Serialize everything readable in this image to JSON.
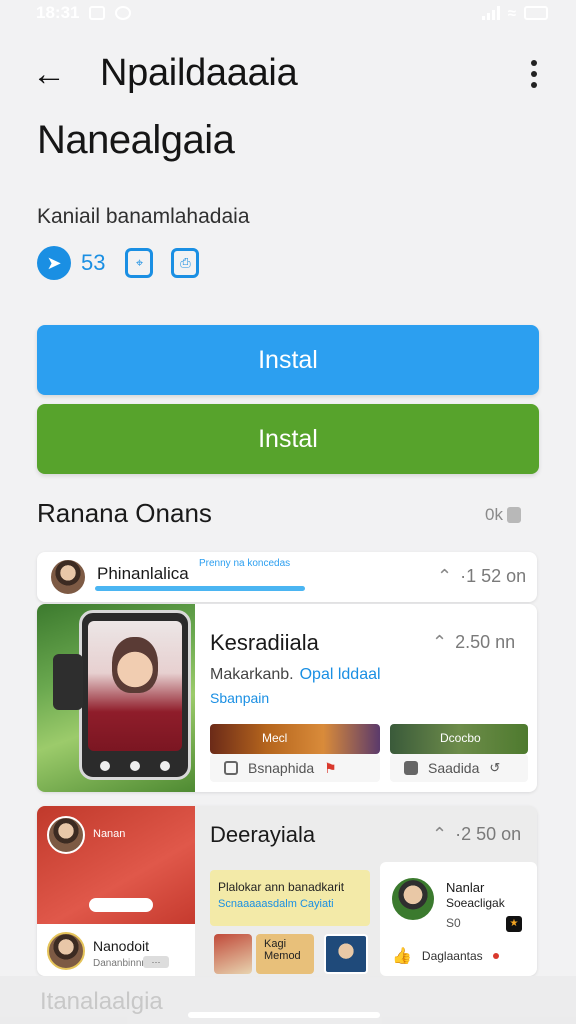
{
  "status_bar": {
    "time": "18:31"
  },
  "app_bar": {
    "title": "Npaildaaaia"
  },
  "app": {
    "name": "Nanealgaia",
    "subtitle": "Kaniail banamlahadaia",
    "rating": "53",
    "meta_icon_1": "⌖",
    "meta_icon_2": "⎙"
  },
  "buttons": {
    "install_primary": "Instal",
    "install_secondary": "Instal"
  },
  "section": {
    "title": "Ranana Onans",
    "meta": "0k"
  },
  "cards": {
    "card1": {
      "name": "Phinanlalica",
      "sub": "Prenny na koncedas",
      "time": "·1 52 on"
    },
    "card2": {
      "title": "Kesradiiala",
      "time": "2.50 nn",
      "desc_a": "Makarkanb.",
      "desc_b": "Opal lddaal",
      "link": "Sbanpain",
      "chip1": "Bsnaphida",
      "chip2": "Saadida",
      "thumb_label_1": "Mecl",
      "thumb_label_2": "Dcocbo"
    },
    "card3": {
      "left_name": "Nanan",
      "left_pill": "",
      "bottom_name": "Nanodoit",
      "bottom_sub": "Dananbinnn",
      "bottom_badge": "···",
      "title": "Deerayiala",
      "time": "·2 50 on",
      "promo_line1": "Plalokar ann banadkarit",
      "promo_line2": "Scnaaaaasdalm Cayiati",
      "thumb_label_a": "Kagi Memod",
      "right_name": "Nanlar",
      "right_sub": "Soeacligak",
      "right_num": "S0",
      "right_action": "Daglaantas"
    }
  },
  "nav": {
    "ghost_text": "Itanalaalgia"
  },
  "colors": {
    "primary_blue": "#2c9ff0",
    "primary_green": "#57a32c",
    "accent_red": "#d9392d",
    "background": "#f2f2f3"
  }
}
